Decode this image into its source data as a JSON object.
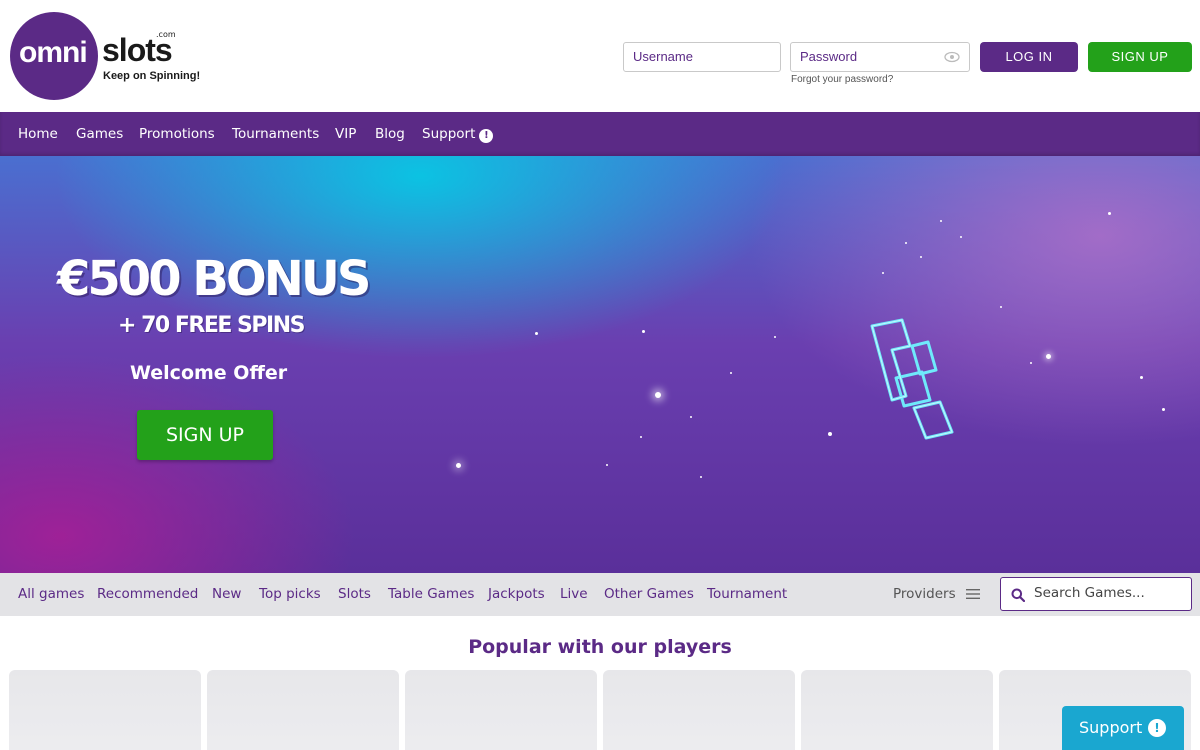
{
  "brand": {
    "logo_omni": "omni",
    "logo_slots": "slots",
    "logo_com": ".com",
    "tagline": "Keep on Spinning!",
    "primary_color": "#5b2a86",
    "accent_green": "#23a11a",
    "support_blue": "#1aa7d0"
  },
  "login": {
    "username_placeholder": "Username",
    "password_placeholder": "Password",
    "forgot_label": "Forgot your password?",
    "login_label": "LOG IN",
    "signup_label": "SIGN UP",
    "eye_icon": "eye-icon"
  },
  "nav": {
    "items": [
      "Home",
      "Games",
      "Promotions",
      "Tournaments",
      "VIP",
      "Blog",
      "Support"
    ],
    "support_badge": "!"
  },
  "hero": {
    "title": "€500 BONUS",
    "subtitle": "+ 70 FREE SPINS",
    "offer": "Welcome Offer",
    "cta_label": "SIGN UP"
  },
  "categories": {
    "items": [
      "All games",
      "Recommended",
      "New",
      "Top picks",
      "Slots",
      "Table Games",
      "Jackpots",
      "Live",
      "Other Games",
      "Tournament"
    ],
    "providers_label": "Providers",
    "menu_icon": "hamburger-icon",
    "search_placeholder": "Search Games...",
    "search_icon": "search-icon"
  },
  "popular": {
    "title": "Popular with our players"
  },
  "support_widget": {
    "label": "Support",
    "badge": "!"
  }
}
